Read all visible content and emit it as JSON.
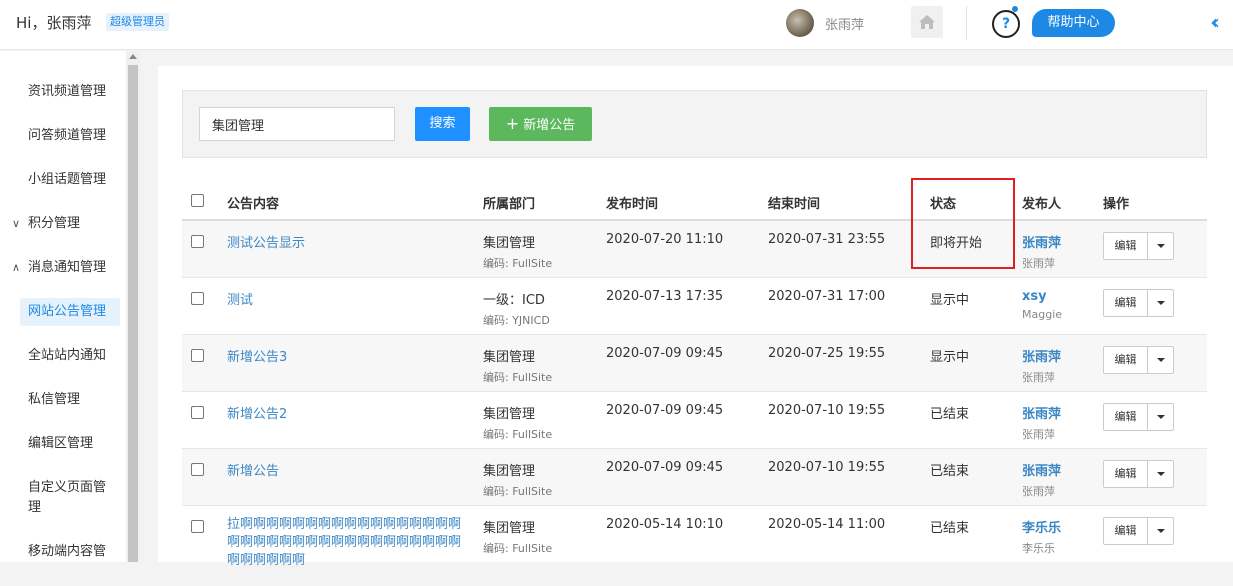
{
  "header": {
    "greeting": "Hi，张雨萍",
    "role_badge": "超级管理员",
    "user_name": "张雨萍",
    "help_label": "帮助中心",
    "colors": {
      "accent": "#1e88e5",
      "add_button": "#5cb85c",
      "highlight": "#e02020"
    }
  },
  "sidebar": {
    "items": [
      {
        "label": "资讯频道管理"
      },
      {
        "label": "问答频道管理"
      },
      {
        "label": "小组话题管理"
      }
    ],
    "groups": [
      {
        "label": "积分管理",
        "chevron": "∨"
      },
      {
        "label": "消息通知管理",
        "chevron": "∧"
      }
    ],
    "active_item": "网站公告管理",
    "sub_items": [
      {
        "label": "全站站内通知"
      },
      {
        "label": "私信管理"
      },
      {
        "label": "编辑区管理"
      },
      {
        "label": "自定义页面管理"
      },
      {
        "label": "移动端内容管"
      }
    ]
  },
  "toolbar": {
    "search_value": "集团管理",
    "search_button": "搜索",
    "add_button": "新增公告"
  },
  "table": {
    "headers": {
      "content": "公告内容",
      "department": "所属部门",
      "publish_time": "发布时间",
      "end_time": "结束时间",
      "status": "状态",
      "publisher": "发布人",
      "actions": "操作"
    },
    "edit_label": "编辑",
    "rows": [
      {
        "title": "测试公告显示",
        "dept": "集团管理",
        "code": "编码: FullSite",
        "publish": "2020-07-20 11:10",
        "end": "2020-07-31 23:55",
        "status": "即将开始",
        "publisher": "张雨萍",
        "publisher_sub": "张雨萍"
      },
      {
        "title": "测试",
        "dept": "一级：ICD",
        "code": "编码: YJNICD",
        "publish": "2020-07-13 17:35",
        "end": "2020-07-31 17:00",
        "status": "显示中",
        "publisher": "xsy",
        "publisher_sub": "Maggie"
      },
      {
        "title": "新增公告3",
        "dept": "集团管理",
        "code": "编码: FullSite",
        "publish": "2020-07-09 09:45",
        "end": "2020-07-25 19:55",
        "status": "显示中",
        "publisher": "张雨萍",
        "publisher_sub": "张雨萍"
      },
      {
        "title": "新增公告2",
        "dept": "集团管理",
        "code": "编码: FullSite",
        "publish": "2020-07-09 09:45",
        "end": "2020-07-10 19:55",
        "status": "已结束",
        "publisher": "张雨萍",
        "publisher_sub": "张雨萍"
      },
      {
        "title": "新增公告",
        "dept": "集团管理",
        "code": "编码: FullSite",
        "publish": "2020-07-09 09:45",
        "end": "2020-07-10 19:55",
        "status": "已结束",
        "publisher": "张雨萍",
        "publisher_sub": "张雨萍"
      },
      {
        "title": "拉啊啊啊啊啊啊啊啊啊啊啊啊啊啊啊啊啊啊啊啊啊啊啊啊啊啊啊啊啊啊啊啊啊啊啊啊啊啊啊啊啊",
        "dept": "集团管理",
        "code": "编码: FullSite",
        "publish": "2020-05-14 10:10",
        "end": "2020-05-14 11:00",
        "status": "已结束",
        "publisher": "李乐乐",
        "publisher_sub": "李乐乐"
      }
    ]
  }
}
